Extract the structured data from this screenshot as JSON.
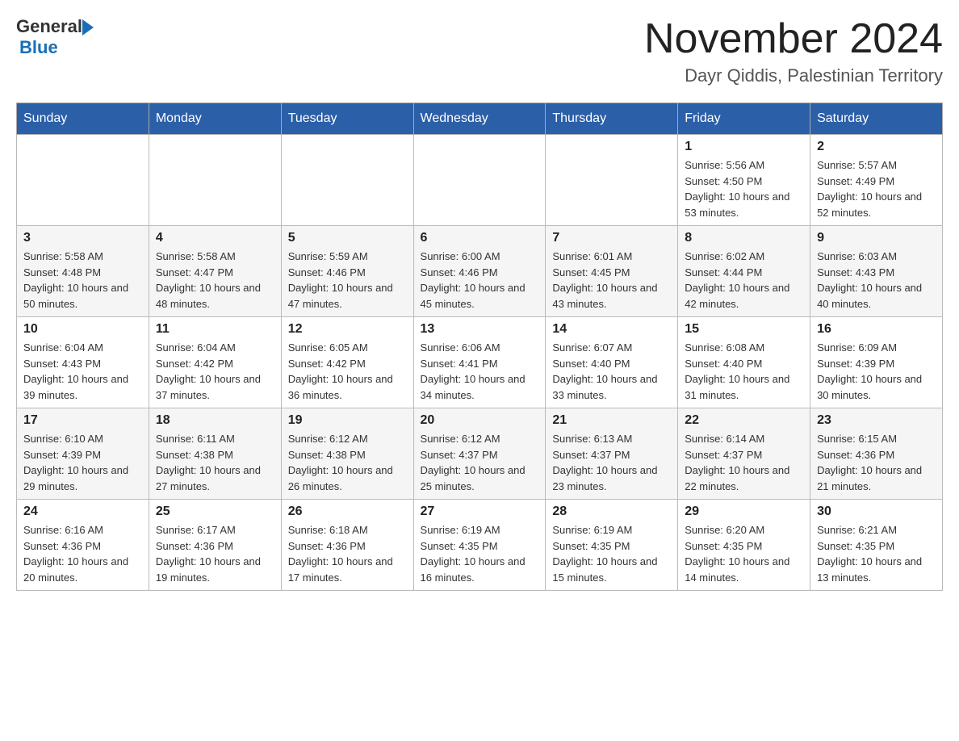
{
  "header": {
    "logo_general": "General",
    "logo_blue": "Blue",
    "month_title": "November 2024",
    "subtitle": "Dayr Qiddis, Palestinian Territory"
  },
  "days_of_week": [
    "Sunday",
    "Monday",
    "Tuesday",
    "Wednesday",
    "Thursday",
    "Friday",
    "Saturday"
  ],
  "weeks": [
    [
      {
        "day": "",
        "sunrise": "",
        "sunset": "",
        "daylight": ""
      },
      {
        "day": "",
        "sunrise": "",
        "sunset": "",
        "daylight": ""
      },
      {
        "day": "",
        "sunrise": "",
        "sunset": "",
        "daylight": ""
      },
      {
        "day": "",
        "sunrise": "",
        "sunset": "",
        "daylight": ""
      },
      {
        "day": "",
        "sunrise": "",
        "sunset": "",
        "daylight": ""
      },
      {
        "day": "1",
        "sunrise": "Sunrise: 5:56 AM",
        "sunset": "Sunset: 4:50 PM",
        "daylight": "Daylight: 10 hours and 53 minutes."
      },
      {
        "day": "2",
        "sunrise": "Sunrise: 5:57 AM",
        "sunset": "Sunset: 4:49 PM",
        "daylight": "Daylight: 10 hours and 52 minutes."
      }
    ],
    [
      {
        "day": "3",
        "sunrise": "Sunrise: 5:58 AM",
        "sunset": "Sunset: 4:48 PM",
        "daylight": "Daylight: 10 hours and 50 minutes."
      },
      {
        "day": "4",
        "sunrise": "Sunrise: 5:58 AM",
        "sunset": "Sunset: 4:47 PM",
        "daylight": "Daylight: 10 hours and 48 minutes."
      },
      {
        "day": "5",
        "sunrise": "Sunrise: 5:59 AM",
        "sunset": "Sunset: 4:46 PM",
        "daylight": "Daylight: 10 hours and 47 minutes."
      },
      {
        "day": "6",
        "sunrise": "Sunrise: 6:00 AM",
        "sunset": "Sunset: 4:46 PM",
        "daylight": "Daylight: 10 hours and 45 minutes."
      },
      {
        "day": "7",
        "sunrise": "Sunrise: 6:01 AM",
        "sunset": "Sunset: 4:45 PM",
        "daylight": "Daylight: 10 hours and 43 minutes."
      },
      {
        "day": "8",
        "sunrise": "Sunrise: 6:02 AM",
        "sunset": "Sunset: 4:44 PM",
        "daylight": "Daylight: 10 hours and 42 minutes."
      },
      {
        "day": "9",
        "sunrise": "Sunrise: 6:03 AM",
        "sunset": "Sunset: 4:43 PM",
        "daylight": "Daylight: 10 hours and 40 minutes."
      }
    ],
    [
      {
        "day": "10",
        "sunrise": "Sunrise: 6:04 AM",
        "sunset": "Sunset: 4:43 PM",
        "daylight": "Daylight: 10 hours and 39 minutes."
      },
      {
        "day": "11",
        "sunrise": "Sunrise: 6:04 AM",
        "sunset": "Sunset: 4:42 PM",
        "daylight": "Daylight: 10 hours and 37 minutes."
      },
      {
        "day": "12",
        "sunrise": "Sunrise: 6:05 AM",
        "sunset": "Sunset: 4:42 PM",
        "daylight": "Daylight: 10 hours and 36 minutes."
      },
      {
        "day": "13",
        "sunrise": "Sunrise: 6:06 AM",
        "sunset": "Sunset: 4:41 PM",
        "daylight": "Daylight: 10 hours and 34 minutes."
      },
      {
        "day": "14",
        "sunrise": "Sunrise: 6:07 AM",
        "sunset": "Sunset: 4:40 PM",
        "daylight": "Daylight: 10 hours and 33 minutes."
      },
      {
        "day": "15",
        "sunrise": "Sunrise: 6:08 AM",
        "sunset": "Sunset: 4:40 PM",
        "daylight": "Daylight: 10 hours and 31 minutes."
      },
      {
        "day": "16",
        "sunrise": "Sunrise: 6:09 AM",
        "sunset": "Sunset: 4:39 PM",
        "daylight": "Daylight: 10 hours and 30 minutes."
      }
    ],
    [
      {
        "day": "17",
        "sunrise": "Sunrise: 6:10 AM",
        "sunset": "Sunset: 4:39 PM",
        "daylight": "Daylight: 10 hours and 29 minutes."
      },
      {
        "day": "18",
        "sunrise": "Sunrise: 6:11 AM",
        "sunset": "Sunset: 4:38 PM",
        "daylight": "Daylight: 10 hours and 27 minutes."
      },
      {
        "day": "19",
        "sunrise": "Sunrise: 6:12 AM",
        "sunset": "Sunset: 4:38 PM",
        "daylight": "Daylight: 10 hours and 26 minutes."
      },
      {
        "day": "20",
        "sunrise": "Sunrise: 6:12 AM",
        "sunset": "Sunset: 4:37 PM",
        "daylight": "Daylight: 10 hours and 25 minutes."
      },
      {
        "day": "21",
        "sunrise": "Sunrise: 6:13 AM",
        "sunset": "Sunset: 4:37 PM",
        "daylight": "Daylight: 10 hours and 23 minutes."
      },
      {
        "day": "22",
        "sunrise": "Sunrise: 6:14 AM",
        "sunset": "Sunset: 4:37 PM",
        "daylight": "Daylight: 10 hours and 22 minutes."
      },
      {
        "day": "23",
        "sunrise": "Sunrise: 6:15 AM",
        "sunset": "Sunset: 4:36 PM",
        "daylight": "Daylight: 10 hours and 21 minutes."
      }
    ],
    [
      {
        "day": "24",
        "sunrise": "Sunrise: 6:16 AM",
        "sunset": "Sunset: 4:36 PM",
        "daylight": "Daylight: 10 hours and 20 minutes."
      },
      {
        "day": "25",
        "sunrise": "Sunrise: 6:17 AM",
        "sunset": "Sunset: 4:36 PM",
        "daylight": "Daylight: 10 hours and 19 minutes."
      },
      {
        "day": "26",
        "sunrise": "Sunrise: 6:18 AM",
        "sunset": "Sunset: 4:36 PM",
        "daylight": "Daylight: 10 hours and 17 minutes."
      },
      {
        "day": "27",
        "sunrise": "Sunrise: 6:19 AM",
        "sunset": "Sunset: 4:35 PM",
        "daylight": "Daylight: 10 hours and 16 minutes."
      },
      {
        "day": "28",
        "sunrise": "Sunrise: 6:19 AM",
        "sunset": "Sunset: 4:35 PM",
        "daylight": "Daylight: 10 hours and 15 minutes."
      },
      {
        "day": "29",
        "sunrise": "Sunrise: 6:20 AM",
        "sunset": "Sunset: 4:35 PM",
        "daylight": "Daylight: 10 hours and 14 minutes."
      },
      {
        "day": "30",
        "sunrise": "Sunrise: 6:21 AM",
        "sunset": "Sunset: 4:35 PM",
        "daylight": "Daylight: 10 hours and 13 minutes."
      }
    ]
  ]
}
